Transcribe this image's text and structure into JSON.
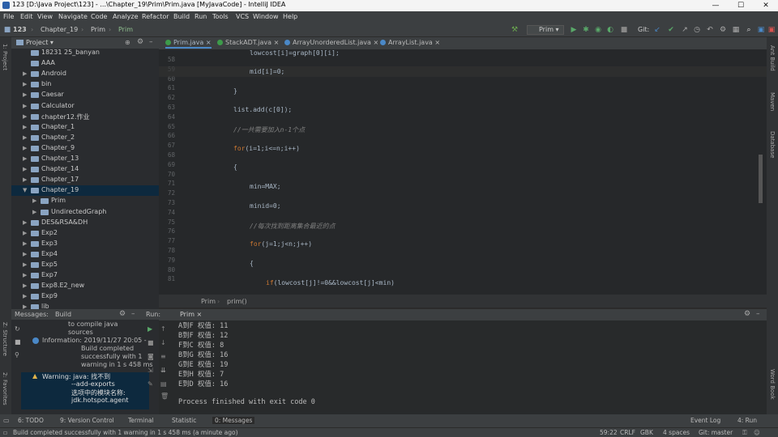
{
  "window": {
    "title": "123 [D:\\Java Project\\123] - ...\\Chapter_19\\Prim\\Prim.java [MyJavaCode] - IntelliJ IDEA"
  },
  "menu": [
    "File",
    "Edit",
    "View",
    "Navigate",
    "Code",
    "Analyze",
    "Refactor",
    "Build",
    "Run",
    "Tools",
    "VCS",
    "Window",
    "Help"
  ],
  "navbar": {
    "crumbs": [
      "123",
      "Chapter_19",
      "Prim",
      "Prim"
    ],
    "run_config": "Prim",
    "git_label": "Git:"
  },
  "left_strip": {
    "project": "1: Project",
    "structure": "Z: Structure",
    "favorites": "2: Favorites"
  },
  "right_strip": {
    "ant": "Ant Build",
    "maven": "Maven",
    "database": "Database",
    "word": "Word Book"
  },
  "project": {
    "header": "Project",
    "items": [
      {
        "label": "18231 25_banyan",
        "depth": 1,
        "arrow": ""
      },
      {
        "label": "AAA",
        "depth": 1,
        "arrow": ""
      },
      {
        "label": "Android",
        "depth": 1,
        "arrow": "▶"
      },
      {
        "label": "bin",
        "depth": 1,
        "arrow": "▶"
      },
      {
        "label": "Caesar",
        "depth": 1,
        "arrow": "▶"
      },
      {
        "label": "Calculator",
        "depth": 1,
        "arrow": "▶"
      },
      {
        "label": "chapter12.作业",
        "depth": 1,
        "arrow": "▶"
      },
      {
        "label": "Chapter_1",
        "depth": 1,
        "arrow": "▶"
      },
      {
        "label": "Chapter_2",
        "depth": 1,
        "arrow": "▶"
      },
      {
        "label": "Chapter_9",
        "depth": 1,
        "arrow": "▶"
      },
      {
        "label": "Chapter_13",
        "depth": 1,
        "arrow": "▶"
      },
      {
        "label": "Chapter_14",
        "depth": 1,
        "arrow": "▶"
      },
      {
        "label": "Chapter_17",
        "depth": 1,
        "arrow": "▶"
      },
      {
        "label": "Chapter_19",
        "depth": 1,
        "arrow": "▼",
        "selected": true
      },
      {
        "label": "Prim",
        "depth": 2,
        "arrow": "▶"
      },
      {
        "label": "UndirectedGraph",
        "depth": 2,
        "arrow": "▶"
      },
      {
        "label": "DES&RSA&DH",
        "depth": 1,
        "arrow": "▶"
      },
      {
        "label": "Exp2",
        "depth": 1,
        "arrow": "▶"
      },
      {
        "label": "Exp3",
        "depth": 1,
        "arrow": "▶"
      },
      {
        "label": "Exp4",
        "depth": 1,
        "arrow": "▶"
      },
      {
        "label": "Exp5",
        "depth": 1,
        "arrow": "▶"
      },
      {
        "label": "Exp7",
        "depth": 1,
        "arrow": "▶"
      },
      {
        "label": "Exp8.E2_new",
        "depth": 1,
        "arrow": "▶"
      },
      {
        "label": "Exp9",
        "depth": 1,
        "arrow": "▶"
      },
      {
        "label": "lib",
        "depth": 1,
        "arrow": "▶"
      }
    ]
  },
  "editor": {
    "tabs": [
      {
        "label": "Prim.java",
        "active": true
      },
      {
        "label": "StackADT.java",
        "active": false
      },
      {
        "label": "ArrayUnorderedList.java",
        "active": false
      },
      {
        "label": "ArrayList.java",
        "active": false
      }
    ],
    "line_numbers": [
      "58",
      "59",
      "60",
      "61",
      "62",
      "63",
      "64",
      "65",
      "66",
      "67",
      "68",
      "69",
      "70",
      "71",
      "72",
      "73",
      "74",
      "75",
      "76",
      "77",
      "78",
      "79",
      "80",
      "81"
    ],
    "lines": {
      "l58": "lowcost[i]=graph[0][i];",
      "l59": "mid[i]=0;",
      "l61": "}",
      "l63": "list.add(c[0]);",
      "l65": "//一共需要加入n-1个点",
      "l67_kw": "for",
      "l67_rest": "(i=1;i<=n;i++)",
      "l69": "{",
      "l71": "min=MAX;",
      "l73": "minid=0;",
      "l75": "//每次找到距离集合最近的点",
      "l77_kw": "for",
      "l77_rest": "(j=1;j<n;j++)",
      "l79": "{",
      "l81_kw": "if",
      "l81_rest": "(lowcost[j]!=0&&lowcost[j]<min)"
    },
    "breadcrumb": [
      "Prim",
      "prim()"
    ]
  },
  "messages": {
    "header": "Messages:",
    "tab": "Build",
    "entries": [
      "to compile java",
      "sources",
      "Information: 2019/11/27 20:05 -",
      "Build completed",
      "successfully with 1",
      "warning in 1 s 458 ms",
      "Warning: java: 找不到",
      "--add-exports",
      "选项中的模块名称:",
      "jdk.hotspot.agent"
    ]
  },
  "run": {
    "label": "Run:",
    "tab": "Prim",
    "output": [
      "A到F 权值: 11",
      "B到F 权值: 12",
      "F到C 权值: 8",
      "B到G 权值: 16",
      "G到E 权值: 19",
      "E到H 权值: 7",
      "E到D 权值: 16",
      "",
      "Process finished with exit code 0"
    ]
  },
  "bottom_tabs": [
    "6: TODO",
    "9: Version Control",
    "Terminal",
    "Statistic",
    "0: Messages",
    "Event Log",
    "4: Run"
  ],
  "status": {
    "message": "Build completed successfully with 1 warning in 1 s 458 ms (a minute ago)",
    "position": "59:22",
    "line_sep": "CRLF",
    "encoding": "GBK",
    "indent": "4 spaces",
    "branch": "Git: master"
  },
  "colors": {
    "keyword": "#cc7832",
    "comment": "#808080",
    "selection": "#0d293e",
    "accent": "#4a88c7"
  }
}
